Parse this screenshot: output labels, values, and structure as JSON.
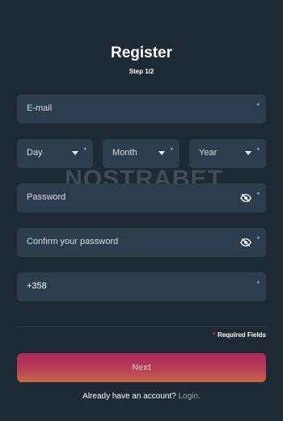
{
  "header": {
    "title": "Register",
    "step": "Step 1/2"
  },
  "form": {
    "email_label": "E-mail",
    "day_label": "Day",
    "month_label": "Month",
    "year_label": "Year",
    "password_label": "Password",
    "confirm_password_label": "Confirm your password",
    "phone_value": "+358",
    "required_marker": "*"
  },
  "footer": {
    "required_star": "*",
    "required_text": "Required Fields",
    "next_label": "Next",
    "login_prompt": "Already have an account?",
    "login_link": "Login."
  },
  "watermark": {
    "text": "NOSTRABET"
  },
  "colors": {
    "background": "#1d2a35",
    "field": "#2c3d4c",
    "accent": "#a8285a",
    "required_star": "#e0284b"
  },
  "icons": [
    "eye-off-icon",
    "chevron-down-icon"
  ]
}
